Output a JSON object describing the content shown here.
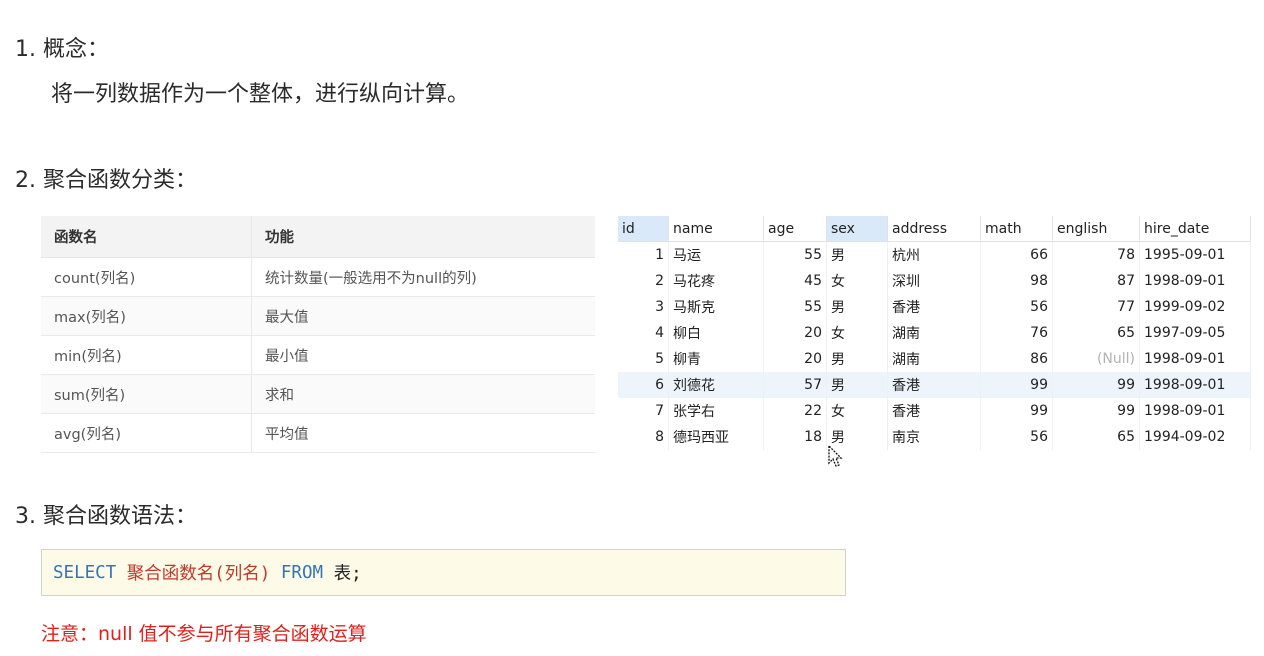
{
  "sections": {
    "concept": {
      "heading": "1. 概念：",
      "text": "将一列数据作为一个整体，进行纵向计算。"
    },
    "classification": {
      "heading": "2. 聚合函数分类："
    },
    "syntax": {
      "heading": "3. 聚合函数语法："
    }
  },
  "func_table": {
    "headers": [
      "函数名",
      "功能"
    ],
    "rows": [
      [
        "count(列名)",
        "统计数量(一般选用不为null的列)"
      ],
      [
        "max(列名)",
        "最大值"
      ],
      [
        "min(列名)",
        "最小值"
      ],
      [
        "sum(列名)",
        "求和"
      ],
      [
        "avg(列名)",
        "平均值"
      ]
    ]
  },
  "data_table": {
    "headers": [
      "id",
      "name",
      "age",
      "sex",
      "address",
      "math",
      "english",
      "hire_date"
    ],
    "rows": [
      [
        "1",
        "马运",
        "55",
        "男",
        "杭州",
        "66",
        "78",
        "1995-09-01"
      ],
      [
        "2",
        "马花疼",
        "45",
        "女",
        "深圳",
        "98",
        "87",
        "1998-09-01"
      ],
      [
        "3",
        "马斯克",
        "55",
        "男",
        "香港",
        "56",
        "77",
        "1999-09-02"
      ],
      [
        "4",
        "柳白",
        "20",
        "女",
        "湖南",
        "76",
        "65",
        "1997-09-05"
      ],
      [
        "5",
        "柳青",
        "20",
        "男",
        "湖南",
        "86",
        "(Null)",
        "1998-09-01"
      ],
      [
        "6",
        "刘德花",
        "57",
        "男",
        "香港",
        "99",
        "99",
        "1998-09-01"
      ],
      [
        "7",
        "张学右",
        "22",
        "女",
        "香港",
        "99",
        "99",
        "1998-09-01"
      ],
      [
        "8",
        "德玛西亚",
        "18",
        "男",
        "南京",
        "56",
        "65",
        "1994-09-02"
      ]
    ]
  },
  "code": {
    "select": "SELECT",
    "func": "聚合函数名(列名)",
    "from": "FROM",
    "table": "表;"
  },
  "note": "注意：null 值不参与所有聚合函数运算"
}
